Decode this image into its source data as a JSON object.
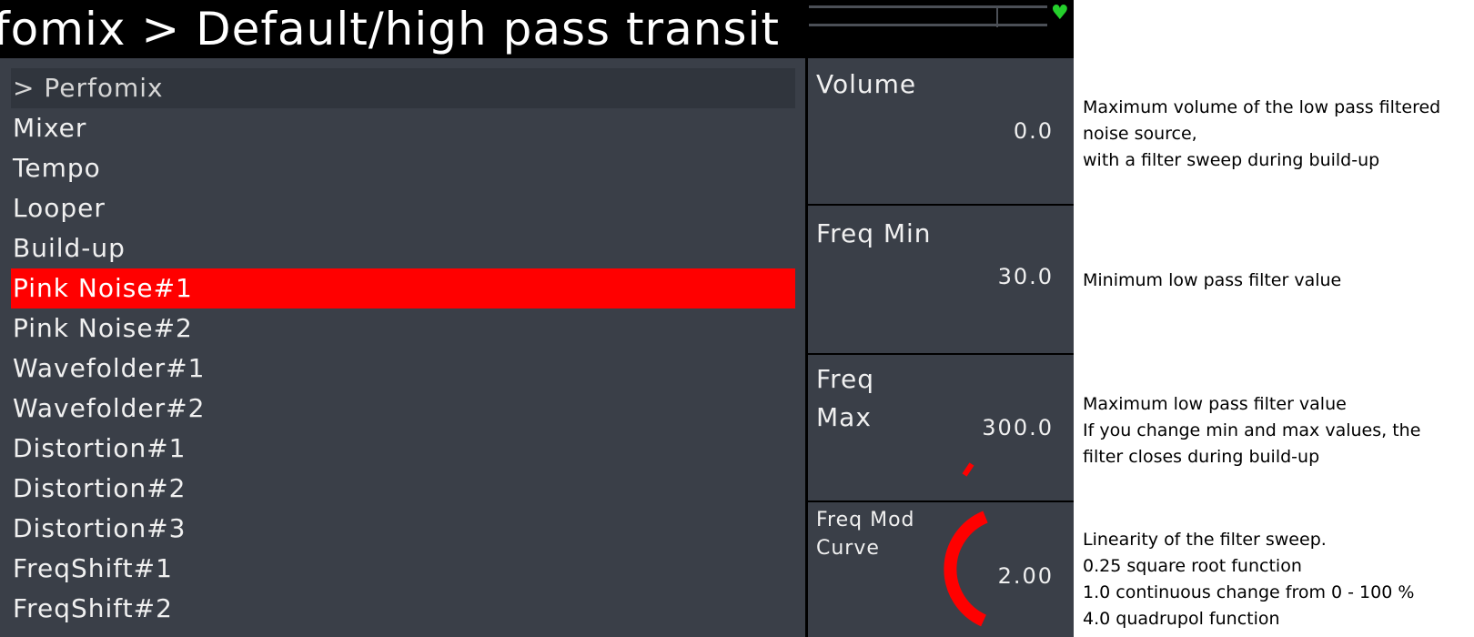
{
  "header": {
    "title": "Perfomix > Default/high pass transit"
  },
  "status": {
    "heart_icon": "heart-icon",
    "heart_color": "#25d02c"
  },
  "menu": {
    "parent_label": "> Perfomix",
    "items": [
      {
        "label": "Mixer"
      },
      {
        "label": "Tempo"
      },
      {
        "label": "Looper"
      },
      {
        "label": "Build-up"
      },
      {
        "label": "Pink Noise#1",
        "selected": true
      },
      {
        "label": "Pink Noise#2"
      },
      {
        "label": "Wavefolder#1"
      },
      {
        "label": "Wavefolder#2"
      },
      {
        "label": "Distortion#1"
      },
      {
        "label": "Distortion#2"
      },
      {
        "label": "Distortion#3"
      },
      {
        "label": "FreqShift#1"
      },
      {
        "label": "FreqShift#2"
      }
    ],
    "selected_color": "#ff0000"
  },
  "params": [
    {
      "label": "Volume",
      "value": "0.0",
      "level": 0.0
    },
    {
      "label": "Freq Min",
      "value": "30.0",
      "level": 0.0
    },
    {
      "label": "Freq\nMax",
      "value": "300.0",
      "level": 0.05
    },
    {
      "label": "Freq Mod\nCurve",
      "value": "2.00",
      "level": 0.35
    }
  ],
  "descriptions": [
    "Maximum volume of the low pass filtered\nnoise source,\nwith a filter sweep during build-up",
    "Minimum low pass filter value",
    "Maximum low pass filter value\nIf you change min and max values, the\nfilter closes during build-up",
    "Linearity of the filter sweep.\n0.25 square root function\n1.0 continuous change from 0 - 100 %\n4.0 quadrupol function"
  ],
  "colors": {
    "background": "#3a3f48",
    "accent": "#ff0000",
    "text": "#f0f0f0"
  }
}
